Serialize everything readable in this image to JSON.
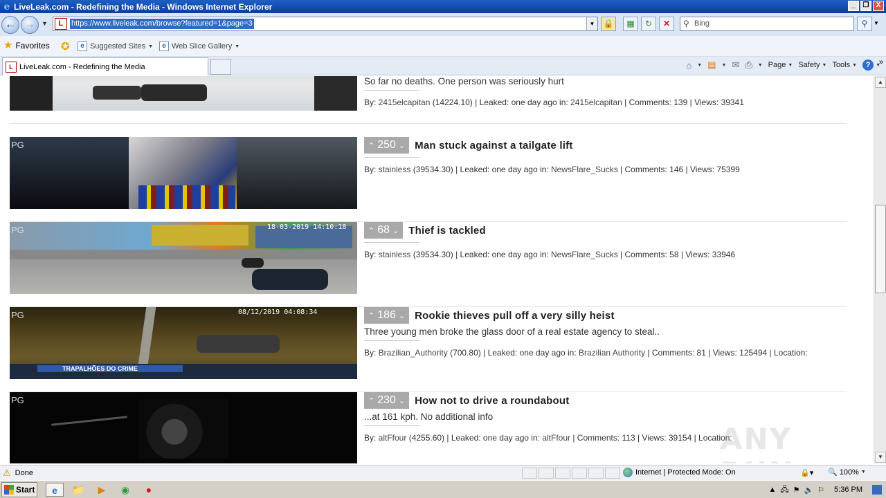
{
  "window": {
    "title": "LiveLeak.com - Redefining the Media - Windows Internet Explorer",
    "minimize": "_",
    "restore": "❐",
    "close": "X"
  },
  "addressbar": {
    "url": "https://www.liveleak.com/browse?featured=1&page=3",
    "search_value": "Bing"
  },
  "favorites": {
    "label": "Favorites",
    "links": [
      {
        "label": "Suggested Sites"
      },
      {
        "label": "Web Slice Gallery"
      }
    ]
  },
  "tabs": [
    {
      "label": "LiveLeak.com - Redefining the Media"
    }
  ],
  "commandbar": {
    "page": "Page",
    "safety": "Safety",
    "tools": "Tools",
    "help": "?"
  },
  "partial_item": {
    "desc": "So far no deaths. One person was seriously hurt",
    "by_prefix": "By: ",
    "user": "2415elcapitan",
    "score": "(14224.10)",
    "leaked": "| Leaked: one day ago in:",
    "channel": "2415elcapitan",
    "stats": "| Comments: 139 | Views: 39341"
  },
  "items": [
    {
      "rating": "PG",
      "votes": "250",
      "title": "Man stuck against a tailgate lift",
      "desc": "",
      "by_prefix": "By: ",
      "user": "stainless",
      "score": "(39534.30)",
      "leaked": "| Leaked: one day ago in:",
      "channel": "NewsFlare_Sucks",
      "stats": "| Comments: 146 | Views: 75399"
    },
    {
      "rating": "PG",
      "votes": "68",
      "title": "Thief is tackled",
      "desc": "",
      "by_prefix": "By: ",
      "user": "stainless",
      "score": "(39534.30)",
      "leaked": "| Leaked: one day ago in:",
      "channel": "NewsFlare_Sucks",
      "stats": "| Comments: 58 | Views: 33946"
    },
    {
      "rating": "PG",
      "votes": "186",
      "title": "Rookie thieves pull off a very silly heist",
      "desc": "Three young men broke the glass door of a real estate agency to steal..",
      "by_prefix": "By: ",
      "user": "Brazilian_Authority",
      "score": "(700.80)",
      "leaked": "| Leaked: one day ago in:",
      "channel": "Brazilian Authority",
      "stats": "| Comments: 81 | Views: 125494 | Location:"
    },
    {
      "rating": "PG",
      "votes": "230",
      "title": "How not to drive a roundabout",
      "desc": "...at 161 kph. No additional info",
      "by_prefix": "By: ",
      "user": "altFfour",
      "score": "(4255.60)",
      "leaked": "| Leaked: one day ago in:",
      "channel": "altFfour",
      "stats": "| Comments: 113 | Views: 39154 | Location:"
    }
  ],
  "thumb_overlays": {
    "thief_timestamp": "18-03-2019 14:10:18",
    "heist_timestamp": "08/12/2019 04:08:34",
    "heist_banner": "TRAPALHÕES DO CRIME"
  },
  "statusbar": {
    "done": "Done",
    "zone": "Internet | Protected Mode: On",
    "zoom": "100%"
  },
  "taskbar": {
    "start": "Start",
    "clock": "5:36 PM"
  },
  "watermark": "ANY RUN"
}
